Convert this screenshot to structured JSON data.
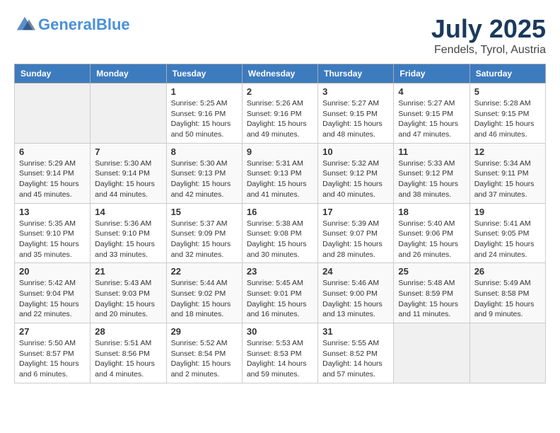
{
  "header": {
    "logo_line1": "General",
    "logo_line2": "Blue",
    "main_title": "July 2025",
    "subtitle": "Fendels, Tyrol, Austria"
  },
  "calendar": {
    "days_of_week": [
      "Sunday",
      "Monday",
      "Tuesday",
      "Wednesday",
      "Thursday",
      "Friday",
      "Saturday"
    ],
    "weeks": [
      [
        {
          "day": "",
          "info": ""
        },
        {
          "day": "",
          "info": ""
        },
        {
          "day": "1",
          "info": "Sunrise: 5:25 AM\nSunset: 9:16 PM\nDaylight: 15 hours\nand 50 minutes."
        },
        {
          "day": "2",
          "info": "Sunrise: 5:26 AM\nSunset: 9:16 PM\nDaylight: 15 hours\nand 49 minutes."
        },
        {
          "day": "3",
          "info": "Sunrise: 5:27 AM\nSunset: 9:15 PM\nDaylight: 15 hours\nand 48 minutes."
        },
        {
          "day": "4",
          "info": "Sunrise: 5:27 AM\nSunset: 9:15 PM\nDaylight: 15 hours\nand 47 minutes."
        },
        {
          "day": "5",
          "info": "Sunrise: 5:28 AM\nSunset: 9:15 PM\nDaylight: 15 hours\nand 46 minutes."
        }
      ],
      [
        {
          "day": "6",
          "info": "Sunrise: 5:29 AM\nSunset: 9:14 PM\nDaylight: 15 hours\nand 45 minutes."
        },
        {
          "day": "7",
          "info": "Sunrise: 5:30 AM\nSunset: 9:14 PM\nDaylight: 15 hours\nand 44 minutes."
        },
        {
          "day": "8",
          "info": "Sunrise: 5:30 AM\nSunset: 9:13 PM\nDaylight: 15 hours\nand 42 minutes."
        },
        {
          "day": "9",
          "info": "Sunrise: 5:31 AM\nSunset: 9:13 PM\nDaylight: 15 hours\nand 41 minutes."
        },
        {
          "day": "10",
          "info": "Sunrise: 5:32 AM\nSunset: 9:12 PM\nDaylight: 15 hours\nand 40 minutes."
        },
        {
          "day": "11",
          "info": "Sunrise: 5:33 AM\nSunset: 9:12 PM\nDaylight: 15 hours\nand 38 minutes."
        },
        {
          "day": "12",
          "info": "Sunrise: 5:34 AM\nSunset: 9:11 PM\nDaylight: 15 hours\nand 37 minutes."
        }
      ],
      [
        {
          "day": "13",
          "info": "Sunrise: 5:35 AM\nSunset: 9:10 PM\nDaylight: 15 hours\nand 35 minutes."
        },
        {
          "day": "14",
          "info": "Sunrise: 5:36 AM\nSunset: 9:10 PM\nDaylight: 15 hours\nand 33 minutes."
        },
        {
          "day": "15",
          "info": "Sunrise: 5:37 AM\nSunset: 9:09 PM\nDaylight: 15 hours\nand 32 minutes."
        },
        {
          "day": "16",
          "info": "Sunrise: 5:38 AM\nSunset: 9:08 PM\nDaylight: 15 hours\nand 30 minutes."
        },
        {
          "day": "17",
          "info": "Sunrise: 5:39 AM\nSunset: 9:07 PM\nDaylight: 15 hours\nand 28 minutes."
        },
        {
          "day": "18",
          "info": "Sunrise: 5:40 AM\nSunset: 9:06 PM\nDaylight: 15 hours\nand 26 minutes."
        },
        {
          "day": "19",
          "info": "Sunrise: 5:41 AM\nSunset: 9:05 PM\nDaylight: 15 hours\nand 24 minutes."
        }
      ],
      [
        {
          "day": "20",
          "info": "Sunrise: 5:42 AM\nSunset: 9:04 PM\nDaylight: 15 hours\nand 22 minutes."
        },
        {
          "day": "21",
          "info": "Sunrise: 5:43 AM\nSunset: 9:03 PM\nDaylight: 15 hours\nand 20 minutes."
        },
        {
          "day": "22",
          "info": "Sunrise: 5:44 AM\nSunset: 9:02 PM\nDaylight: 15 hours\nand 18 minutes."
        },
        {
          "day": "23",
          "info": "Sunrise: 5:45 AM\nSunset: 9:01 PM\nDaylight: 15 hours\nand 16 minutes."
        },
        {
          "day": "24",
          "info": "Sunrise: 5:46 AM\nSunset: 9:00 PM\nDaylight: 15 hours\nand 13 minutes."
        },
        {
          "day": "25",
          "info": "Sunrise: 5:48 AM\nSunset: 8:59 PM\nDaylight: 15 hours\nand 11 minutes."
        },
        {
          "day": "26",
          "info": "Sunrise: 5:49 AM\nSunset: 8:58 PM\nDaylight: 15 hours\nand 9 minutes."
        }
      ],
      [
        {
          "day": "27",
          "info": "Sunrise: 5:50 AM\nSunset: 8:57 PM\nDaylight: 15 hours\nand 6 minutes."
        },
        {
          "day": "28",
          "info": "Sunrise: 5:51 AM\nSunset: 8:56 PM\nDaylight: 15 hours\nand 4 minutes."
        },
        {
          "day": "29",
          "info": "Sunrise: 5:52 AM\nSunset: 8:54 PM\nDaylight: 15 hours\nand 2 minutes."
        },
        {
          "day": "30",
          "info": "Sunrise: 5:53 AM\nSunset: 8:53 PM\nDaylight: 14 hours\nand 59 minutes."
        },
        {
          "day": "31",
          "info": "Sunrise: 5:55 AM\nSunset: 8:52 PM\nDaylight: 14 hours\nand 57 minutes."
        },
        {
          "day": "",
          "info": ""
        },
        {
          "day": "",
          "info": ""
        }
      ]
    ]
  }
}
